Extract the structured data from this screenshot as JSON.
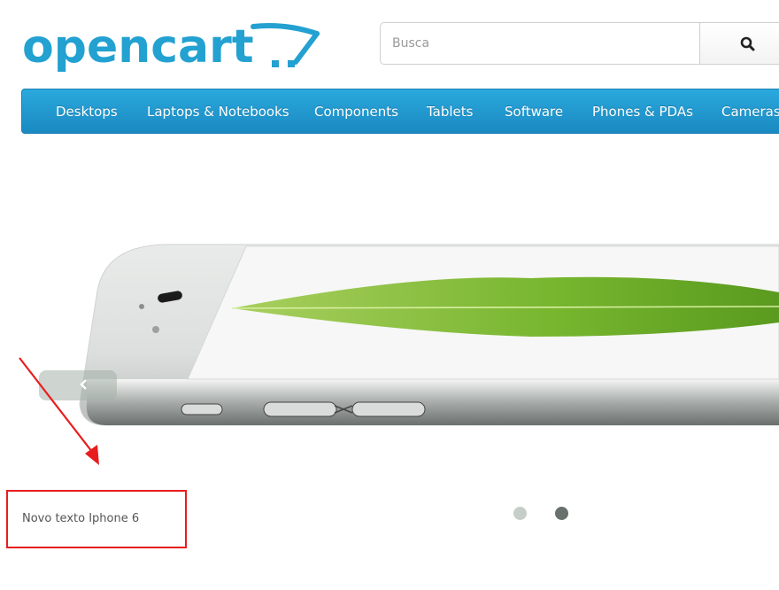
{
  "logo": {
    "text": "opencart"
  },
  "search": {
    "placeholder": "Busca",
    "button_icon": "search-icon"
  },
  "menu": {
    "items": [
      "Desktops",
      "Laptops & Notebooks",
      "Components",
      "Tablets",
      "Software",
      "Phones & PDAs",
      "Cameras"
    ]
  },
  "slideshow": {
    "caption": "Novo texto Iphone 6",
    "active_dot": 2,
    "dots": 2
  },
  "colors": {
    "brand": "#23a1d1",
    "menu_top": "#2aa9dd",
    "menu_bottom": "#1a89c2",
    "annotation": "#e81d1d"
  }
}
